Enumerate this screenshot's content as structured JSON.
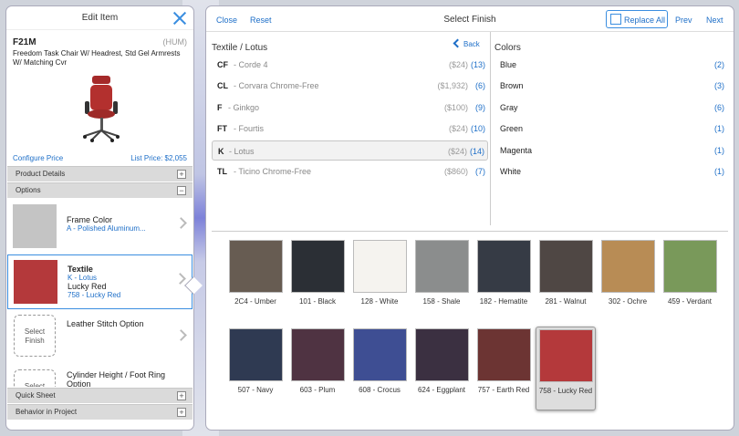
{
  "left_panel": {
    "title": "Edit Item",
    "code": "F21M",
    "tag": "(HUM)",
    "description": "Freedom Task Chair W/ Headrest, Std Gel Armrests W/ Matching Cvr",
    "configure_price": "Configure Price",
    "list_price": "List Price: $2,055",
    "sections": {
      "product_details": "Product Details",
      "options": "Options",
      "quick_sheet": "Quick Sheet",
      "behavior": "Behavior in Project"
    },
    "options": [
      {
        "title": "Frame Color",
        "line1": "A - Polished Aluminum..."
      },
      {
        "title": "Textile",
        "line1": "K - Lotus",
        "title2": "Lucky Red",
        "line2": "758 - Lucky Red"
      },
      {
        "title": "Leather Stitch Option",
        "placeholder": "Select Finish"
      },
      {
        "title": "Cylinder Height / Foot Ring Option",
        "placeholder": "Select"
      }
    ]
  },
  "right_panel": {
    "close": "Close",
    "reset": "Reset",
    "title": "Select Finish",
    "replace_all": "Replace All",
    "prev": "Prev",
    "next": "Next",
    "textile_header": "Textile / Lotus",
    "back": "Back",
    "colors_header": "Colors",
    "textiles": [
      {
        "code": "CF",
        "name": "- Corde 4",
        "price": "($24)",
        "count": "(13)"
      },
      {
        "code": "CL",
        "name": "- Corvara Chrome-Free",
        "price": "($1,932)",
        "count": "(6)"
      },
      {
        "code": "F",
        "name": "- Ginkgo",
        "price": "($100)",
        "count": "(9)"
      },
      {
        "code": "FT",
        "name": "- Fourtis",
        "price": "($24)",
        "count": "(10)"
      },
      {
        "code": "K",
        "name": "- Lotus",
        "price": "($24)",
        "count": "(14)"
      },
      {
        "code": "TL",
        "name": "- Ticino Chrome-Free",
        "price": "($860)",
        "count": "(7)"
      }
    ],
    "colors": [
      {
        "name": "Blue",
        "count": "(2)"
      },
      {
        "name": "Brown",
        "count": "(3)"
      },
      {
        "name": "Gray",
        "count": "(6)"
      },
      {
        "name": "Green",
        "count": "(1)"
      },
      {
        "name": "Magenta",
        "count": "(1)"
      },
      {
        "name": "White",
        "count": "(1)"
      }
    ],
    "swatches": [
      {
        "label": "2C4 - Umber",
        "color": "#675c52"
      },
      {
        "label": "101 - Black",
        "color": "#2b2f35"
      },
      {
        "label": "128 - White",
        "color": "#f5f3ef"
      },
      {
        "label": "158 - Shale",
        "color": "#8b8d8d"
      },
      {
        "label": "182 - Hematite",
        "color": "#363b45"
      },
      {
        "label": "281 - Walnut",
        "color": "#4f4744"
      },
      {
        "label": "302 - Ochre",
        "color": "#b88c55"
      },
      {
        "label": "459 - Verdant",
        "color": "#79995a"
      },
      {
        "label": "507 - Navy",
        "color": "#2f3a52"
      },
      {
        "label": "603 - Plum",
        "color": "#4f3342"
      },
      {
        "label": "608 - Crocus",
        "color": "#3e4e93"
      },
      {
        "label": "624 - Eggplant",
        "color": "#3b3041"
      },
      {
        "label": "757 - Earth Red",
        "color": "#6c3433"
      },
      {
        "label": "758 - Lucky Red",
        "color": "#b4393b"
      }
    ]
  }
}
